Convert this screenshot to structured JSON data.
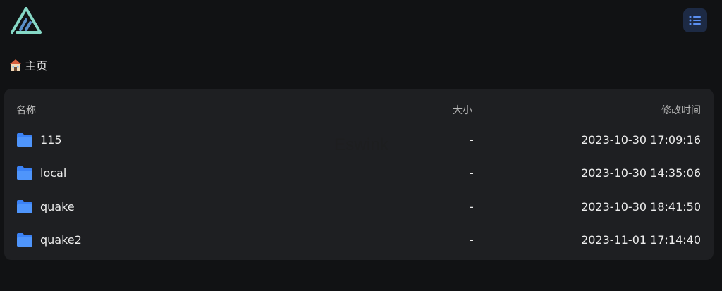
{
  "header": {
    "logo_icon": "alist-logo-icon",
    "menu_icon": "list-icon"
  },
  "breadcrumb": {
    "home_icon": "house-icon",
    "label": "主页"
  },
  "table": {
    "headers": {
      "name": "名称",
      "size": "大小",
      "modified": "修改时间"
    },
    "rows": [
      {
        "name": "115",
        "size": "-",
        "modified": "2023-10-30 17:09:16",
        "icon": "folder-icon"
      },
      {
        "name": "local",
        "size": "-",
        "modified": "2023-10-30 14:35:06",
        "icon": "folder-icon"
      },
      {
        "name": "quake",
        "size": "-",
        "modified": "2023-10-30 18:41:50",
        "icon": "folder-icon"
      },
      {
        "name": "quake2",
        "size": "-",
        "modified": "2023-11-01 17:14:40",
        "icon": "folder-icon"
      }
    ]
  },
  "watermark": "Eswink",
  "colors": {
    "background": "#111214",
    "panel": "#1e1f22",
    "accent": "#3b82f6",
    "logo": "#86d8c6"
  }
}
